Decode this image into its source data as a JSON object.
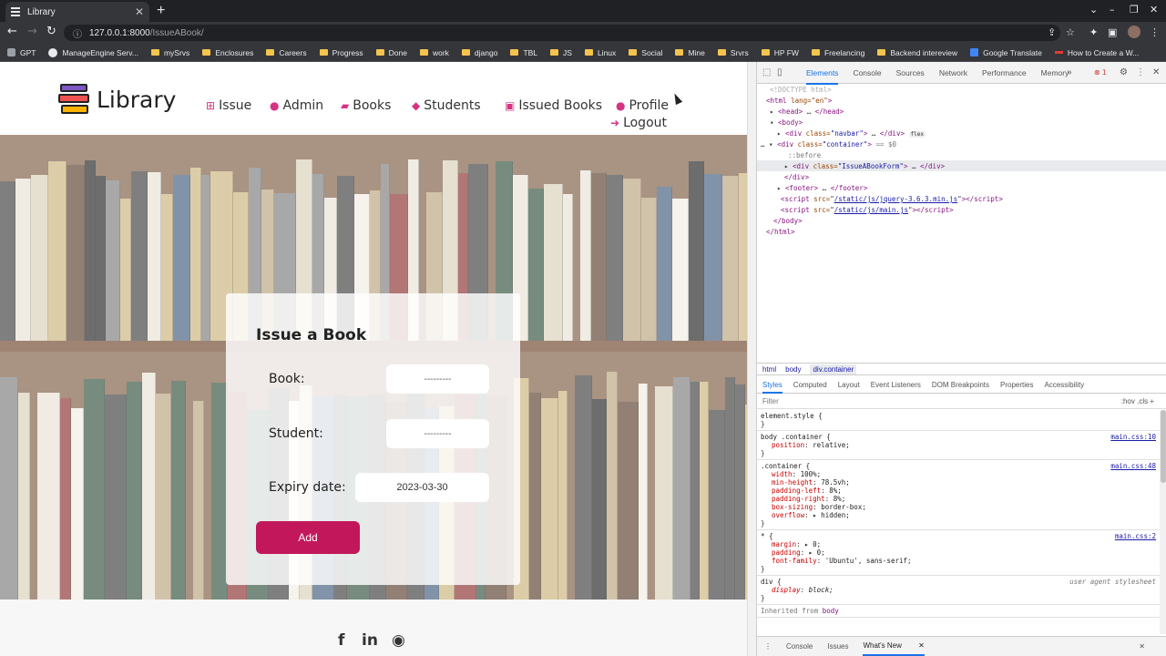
{
  "browser": {
    "tab_title": "Library",
    "url_host": "127.0.0.1:8000",
    "url_path": "/IssueABook/",
    "bookmarks": [
      "GPT",
      "ManageEngine Serv...",
      "mySrvs",
      "Enclosures",
      "Careers",
      "Progress",
      "Done",
      "work",
      "django",
      "TBL",
      "JS",
      "Linux",
      "Social",
      "Mine",
      "Srvrs",
      "HP FW",
      "Freelancing",
      "Backend intereview",
      "Google Translate",
      "How to Create a W..."
    ]
  },
  "site": {
    "logo_text": "Library",
    "menu": {
      "issue": "Issue",
      "admin": "Admin",
      "books": "Books",
      "students": "Students",
      "issued_books": "Issued Books",
      "profile": "Profile",
      "logout": "Logout"
    }
  },
  "form": {
    "title": "Issue a Book",
    "book_label": "Book:",
    "book_value": "---------",
    "student_label": "Student:",
    "student_value": "---------",
    "expiry_label": "Expiry date:",
    "expiry_value": "2023-03-30",
    "add_label": "Add"
  },
  "devtools": {
    "tabs": [
      "Elements",
      "Console",
      "Sources",
      "Network",
      "Performance",
      "Memory"
    ],
    "error_count": "1",
    "dom": {
      "doctype": "<!DOCTYPE html>",
      "html_open": "lang=\"en\"",
      "head": "<head>",
      "head_close": "</head>",
      "body": "<body>",
      "navbar_class": "navbar",
      "flex_badge": "flex",
      "container_class": "container",
      "selected_marker": "== $0",
      "before": "::before",
      "form_class": "IssueABookForm",
      "div_close": "</div>",
      "footer": "<footer>",
      "footer_close": "</footer>",
      "script1": "/static/js/jquery-3.6.3.min.js",
      "script2": "/static/js/main.js",
      "body_close": "</body>",
      "html_close": "</html>"
    },
    "breadcrumbs": [
      "html",
      "body",
      "div.container"
    ],
    "style_tabs": [
      "Styles",
      "Computed",
      "Layout",
      "Event Listeners",
      "DOM Breakpoints",
      "Properties",
      "Accessibility"
    ],
    "filter_placeholder": "Filter",
    "filter_right": ":hov  .cls  +",
    "rules": {
      "element_style": "element.style {",
      "r1_sel": "body .container {",
      "r1_src": "main.css:10",
      "r1_p1n": "position",
      "r1_p1v": "relative;",
      "r2_sel": ".container {",
      "r2_src": "main.css:48",
      "r2_props": [
        {
          "n": "width",
          "v": "100%;"
        },
        {
          "n": "min-height",
          "v": "78.5vh;"
        },
        {
          "n": "padding-left",
          "v": "8%;"
        },
        {
          "n": "padding-right",
          "v": "8%;"
        },
        {
          "n": "box-sizing",
          "v": "border-box;"
        },
        {
          "n": "overflow",
          "v": "▸ hidden;"
        }
      ],
      "r3_sel": "* {",
      "r3_src": "main.css:2",
      "r3_props": [
        {
          "n": "margin",
          "v": "▸ 0;"
        },
        {
          "n": "padding",
          "v": "▸ 0;"
        },
        {
          "n": "font-family",
          "v": "'Ubuntu', sans-serif;"
        }
      ],
      "r4_sel": "div {",
      "r4_src": "user agent stylesheet",
      "r4_p1n": "display",
      "r4_p1v": "block;",
      "inherited": "Inherited from",
      "inherited_el": "body"
    },
    "drawer_tabs": [
      "Console",
      "Issues",
      "What's New"
    ]
  },
  "colors": {
    "accent": "#c2185b",
    "menu_icon": "#d63384",
    "devtools_accent": "#1a73e8"
  }
}
